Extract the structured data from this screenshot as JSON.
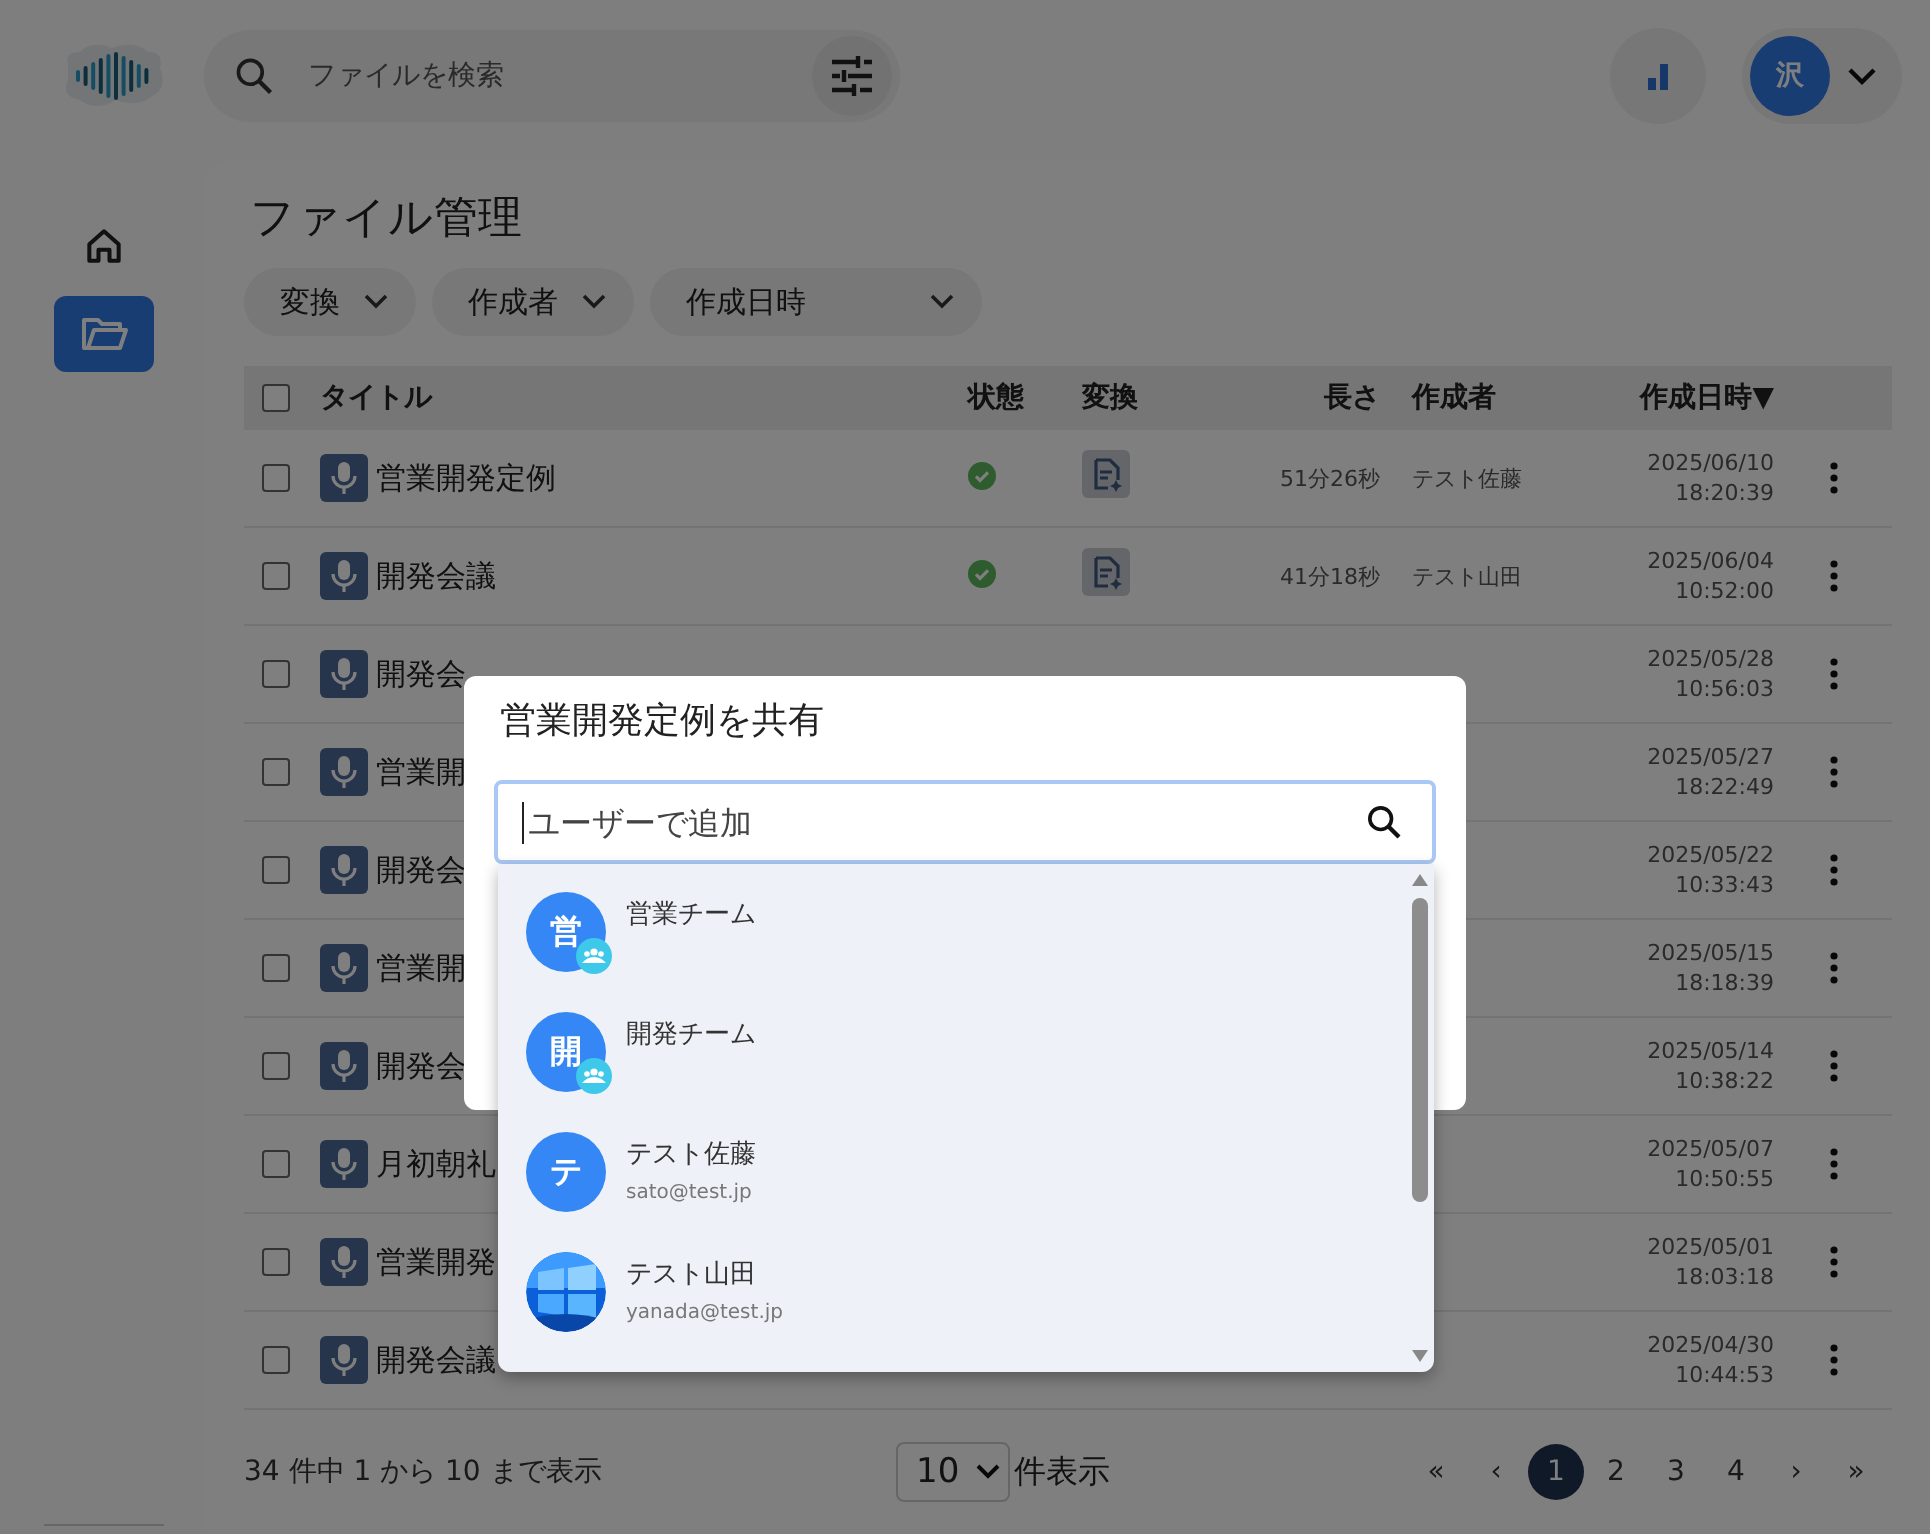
{
  "header": {
    "search": {
      "placeholder": "ファイルを検索"
    },
    "user": {
      "initial": "沢"
    }
  },
  "sidebar": {
    "items": [
      {
        "kind": "home",
        "selected": false
      },
      {
        "kind": "files",
        "selected": true
      }
    ]
  },
  "page_title": "ファイル管理",
  "filters": [
    {
      "label": "変換"
    },
    {
      "label": "作成者"
    },
    {
      "label": "作成日時"
    }
  ],
  "table": {
    "select_all": {
      "checked": false
    },
    "columns": [
      {
        "label": "タイトル"
      },
      {
        "label": "状態"
      },
      {
        "label": "変換"
      },
      {
        "label": "長さ"
      },
      {
        "label": "作成者"
      },
      {
        "label": "作成日時▼"
      }
    ],
    "rows": [
      {
        "checked": false,
        "title": "営業開発定例",
        "completed": true,
        "converted": true,
        "length": "51分26秒",
        "author": "テスト佐藤",
        "date": "2025/06/10",
        "time": "18:20:39"
      },
      {
        "checked": false,
        "title": "開発会議",
        "completed": true,
        "converted": true,
        "length": "41分18秒",
        "author": "テスト山田",
        "date": "2025/06/04",
        "time": "10:52:00"
      },
      {
        "checked": false,
        "title": "開発会",
        "date": "2025/05/28",
        "time": "10:56:03"
      },
      {
        "checked": false,
        "title": "営業開",
        "date": "2025/05/27",
        "time": "18:22:49"
      },
      {
        "checked": false,
        "title": "開発会",
        "date": "2025/05/22",
        "time": "10:33:43"
      },
      {
        "checked": false,
        "title": "営業開",
        "date": "2025/05/15",
        "time": "18:18:39"
      },
      {
        "checked": false,
        "title": "開発会",
        "date": "2025/05/14",
        "time": "10:38:22"
      },
      {
        "checked": false,
        "title": "月初朝礼",
        "date": "2025/05/07",
        "time": "10:50:55"
      },
      {
        "checked": false,
        "title": "営業開発",
        "date": "2025/05/01",
        "time": "18:03:18"
      },
      {
        "checked": false,
        "title": "開発会議",
        "date": "2025/04/30",
        "time": "10:44:53"
      }
    ]
  },
  "footer": {
    "summary": "34 件中 1 から 10 まで表示",
    "page_size": "10",
    "page_size_label": "件表示",
    "pages": [
      {
        "label": "«",
        "selected": false
      },
      {
        "label": "‹",
        "selected": false
      },
      {
        "label": "1",
        "selected": true
      },
      {
        "label": "2",
        "selected": false
      },
      {
        "label": "3",
        "selected": false
      },
      {
        "label": "4",
        "selected": false
      },
      {
        "label": "›",
        "selected": false
      },
      {
        "label": "»",
        "selected": false
      }
    ]
  },
  "dialog": {
    "title": "営業開発定例を共有",
    "search": {
      "placeholder": "ユーザーで追加"
    },
    "options": [
      {
        "kind": "group",
        "initial": "営",
        "name": "営業チーム"
      },
      {
        "kind": "group",
        "initial": "開",
        "name": "開発チーム"
      },
      {
        "kind": "user",
        "initial": "テ",
        "name": "テスト佐藤",
        "email": "sato@test.jp"
      },
      {
        "name": "テスト山田",
        "email": "yanada@test.jp"
      }
    ]
  }
}
